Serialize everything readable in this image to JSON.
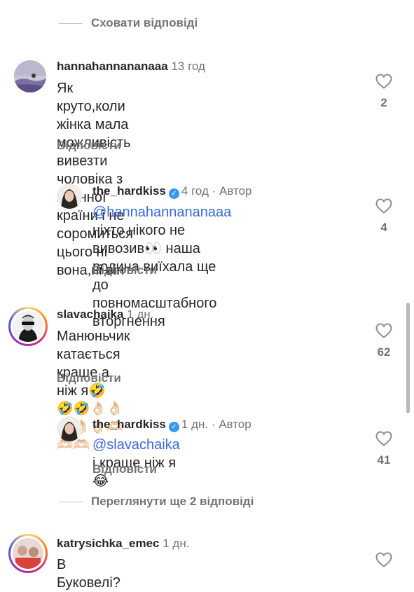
{
  "hide_replies": "Сховати відповіді",
  "comments": [
    {
      "username": "hannahannananaaa",
      "time": "13 год",
      "text": "Як круто,коли жінка мала можливість вивезти чоловіка з воєнної країни і не соромиться цього ні вона,ні він",
      "line1": "Як круто,коли жінка мала можливість",
      "line2": "вивезти чоловіка з воєнної країни і не",
      "line3": "соромиться цього ні вона,ні він",
      "reply_label": "Відповісти",
      "likes": "2"
    },
    {
      "username": "the_hardkiss",
      "time": "4 год",
      "author_badge": "Автор",
      "mention": "@hannahannananaaa",
      "line1_rest": " ніхто нікого не",
      "line2": "вивозив👀 наша родина виїхала ще",
      "line3": "до повномасштабного вторгнення",
      "reply_label": "Відповісти",
      "likes": "4"
    },
    {
      "username": "slavachaika",
      "time": "1 дн.",
      "line1": "Манюньчик катається краще а ніж я🤣",
      "line2": "🤣🤣👌🏻👌🏻👌🏻👌🏻👌🏻🫶🏻🫶🏻🫶🏻",
      "reply_label": "Відповісти",
      "likes": "62"
    },
    {
      "username": "the_hardkiss",
      "time": "1 дн.",
      "author_badge": "Автор",
      "mention": "@slavachaika",
      "line1_rest": " і краще ніж я😂",
      "reply_label": "Відповісти",
      "likes": "41"
    },
    {
      "username": "katrysichka_emec",
      "time": "1 дн.",
      "line1": "В Буковелі?"
    }
  ],
  "view_more_replies": "Переглянути ще 2 відповіді",
  "icons": [
    "heart-icon",
    "verified-badge-icon"
  ]
}
